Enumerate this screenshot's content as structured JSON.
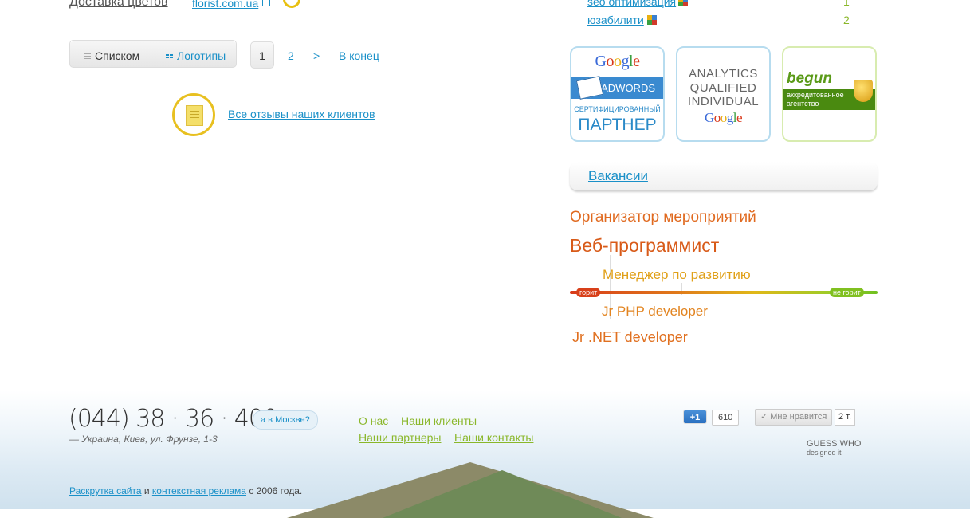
{
  "top_item": {
    "title": "Доставка цветов",
    "site": "florist.com.ua"
  },
  "view_toggle": {
    "list_label": "Списком",
    "logos_label": "Логотипы"
  },
  "pager": {
    "current": "1",
    "page2": "2",
    "next": ">",
    "last": "В конец"
  },
  "reviews": {
    "link": "Все отзывы наших клиентов"
  },
  "tags": [
    {
      "label": "seo оптимизация",
      "count": "1"
    },
    {
      "label": "юзабилити",
      "count": "2"
    }
  ],
  "badges": {
    "adwords": {
      "google": "Google",
      "product": "ADWORDS",
      "small": "СЕРТИФИЦИРОВАННЫЙ",
      "big": "ПАРТНЕР"
    },
    "analytics": {
      "line1": "ANALYTICS",
      "line2": "QUALIFIED",
      "line3": "INDIVIDUAL",
      "google": "Google"
    },
    "begun": {
      "logo": "begun",
      "line1": "аккредитованное",
      "line2": "агентство"
    }
  },
  "vacancies": {
    "title": "Вакансии",
    "jobs": [
      {
        "label": "Организатор мероприятий"
      },
      {
        "label": "Веб-программист"
      },
      {
        "label": "Менеджер по развитию"
      },
      {
        "label": "Jr PHP developer"
      },
      {
        "label": "Jr .NET developer"
      }
    ],
    "heat_left": "горит",
    "heat_right": "не горит"
  },
  "footer": {
    "phone": "(044) 38 · 36 · 400",
    "address": "— Украина, Киев, ул. Фрунзе, 1-3",
    "moscow": "а в Москве?",
    "links": [
      "О нас",
      "Наши клиенты",
      "Наши партнеры",
      "Наши контакты"
    ],
    "gplus": "+1",
    "gplus_count": "610",
    "like_label": "✓ Мне нравится",
    "like_count": "2 т.",
    "guesswho_1": "GUESS WHO",
    "guesswho_2": "designed it",
    "copyright_link1": "Раскрутка сайта",
    "copyright_and": "и",
    "copyright_link2": "контекстная реклама",
    "copyright_tail": "с 2006 года."
  },
  "colors": {
    "link": "#1a90c8",
    "green": "#8ab72a",
    "orange": "#e46a1e"
  }
}
